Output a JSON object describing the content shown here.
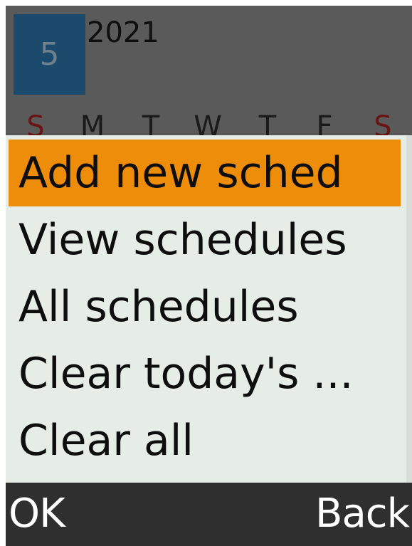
{
  "calendar": {
    "month": "5",
    "year": "2021",
    "weekdays": [
      "S",
      "M",
      "T",
      "W",
      "T",
      "F",
      "S"
    ]
  },
  "menu": {
    "items": [
      {
        "label": "Add new sched",
        "selected": true
      },
      {
        "label": "View schedules",
        "selected": false
      },
      {
        "label": "All schedules",
        "selected": false
      },
      {
        "label": "Clear today's ...",
        "selected": false
      },
      {
        "label": "Clear all",
        "selected": false
      }
    ]
  },
  "softkeys": {
    "left": "OK",
    "right": "Back"
  },
  "colors": {
    "highlight": "#ee8d0a",
    "menu_background": "#e6ede6",
    "weekend": "#6b1414",
    "month_box": "#1b4a6d",
    "softkey_bar": "#2f2f2f"
  }
}
